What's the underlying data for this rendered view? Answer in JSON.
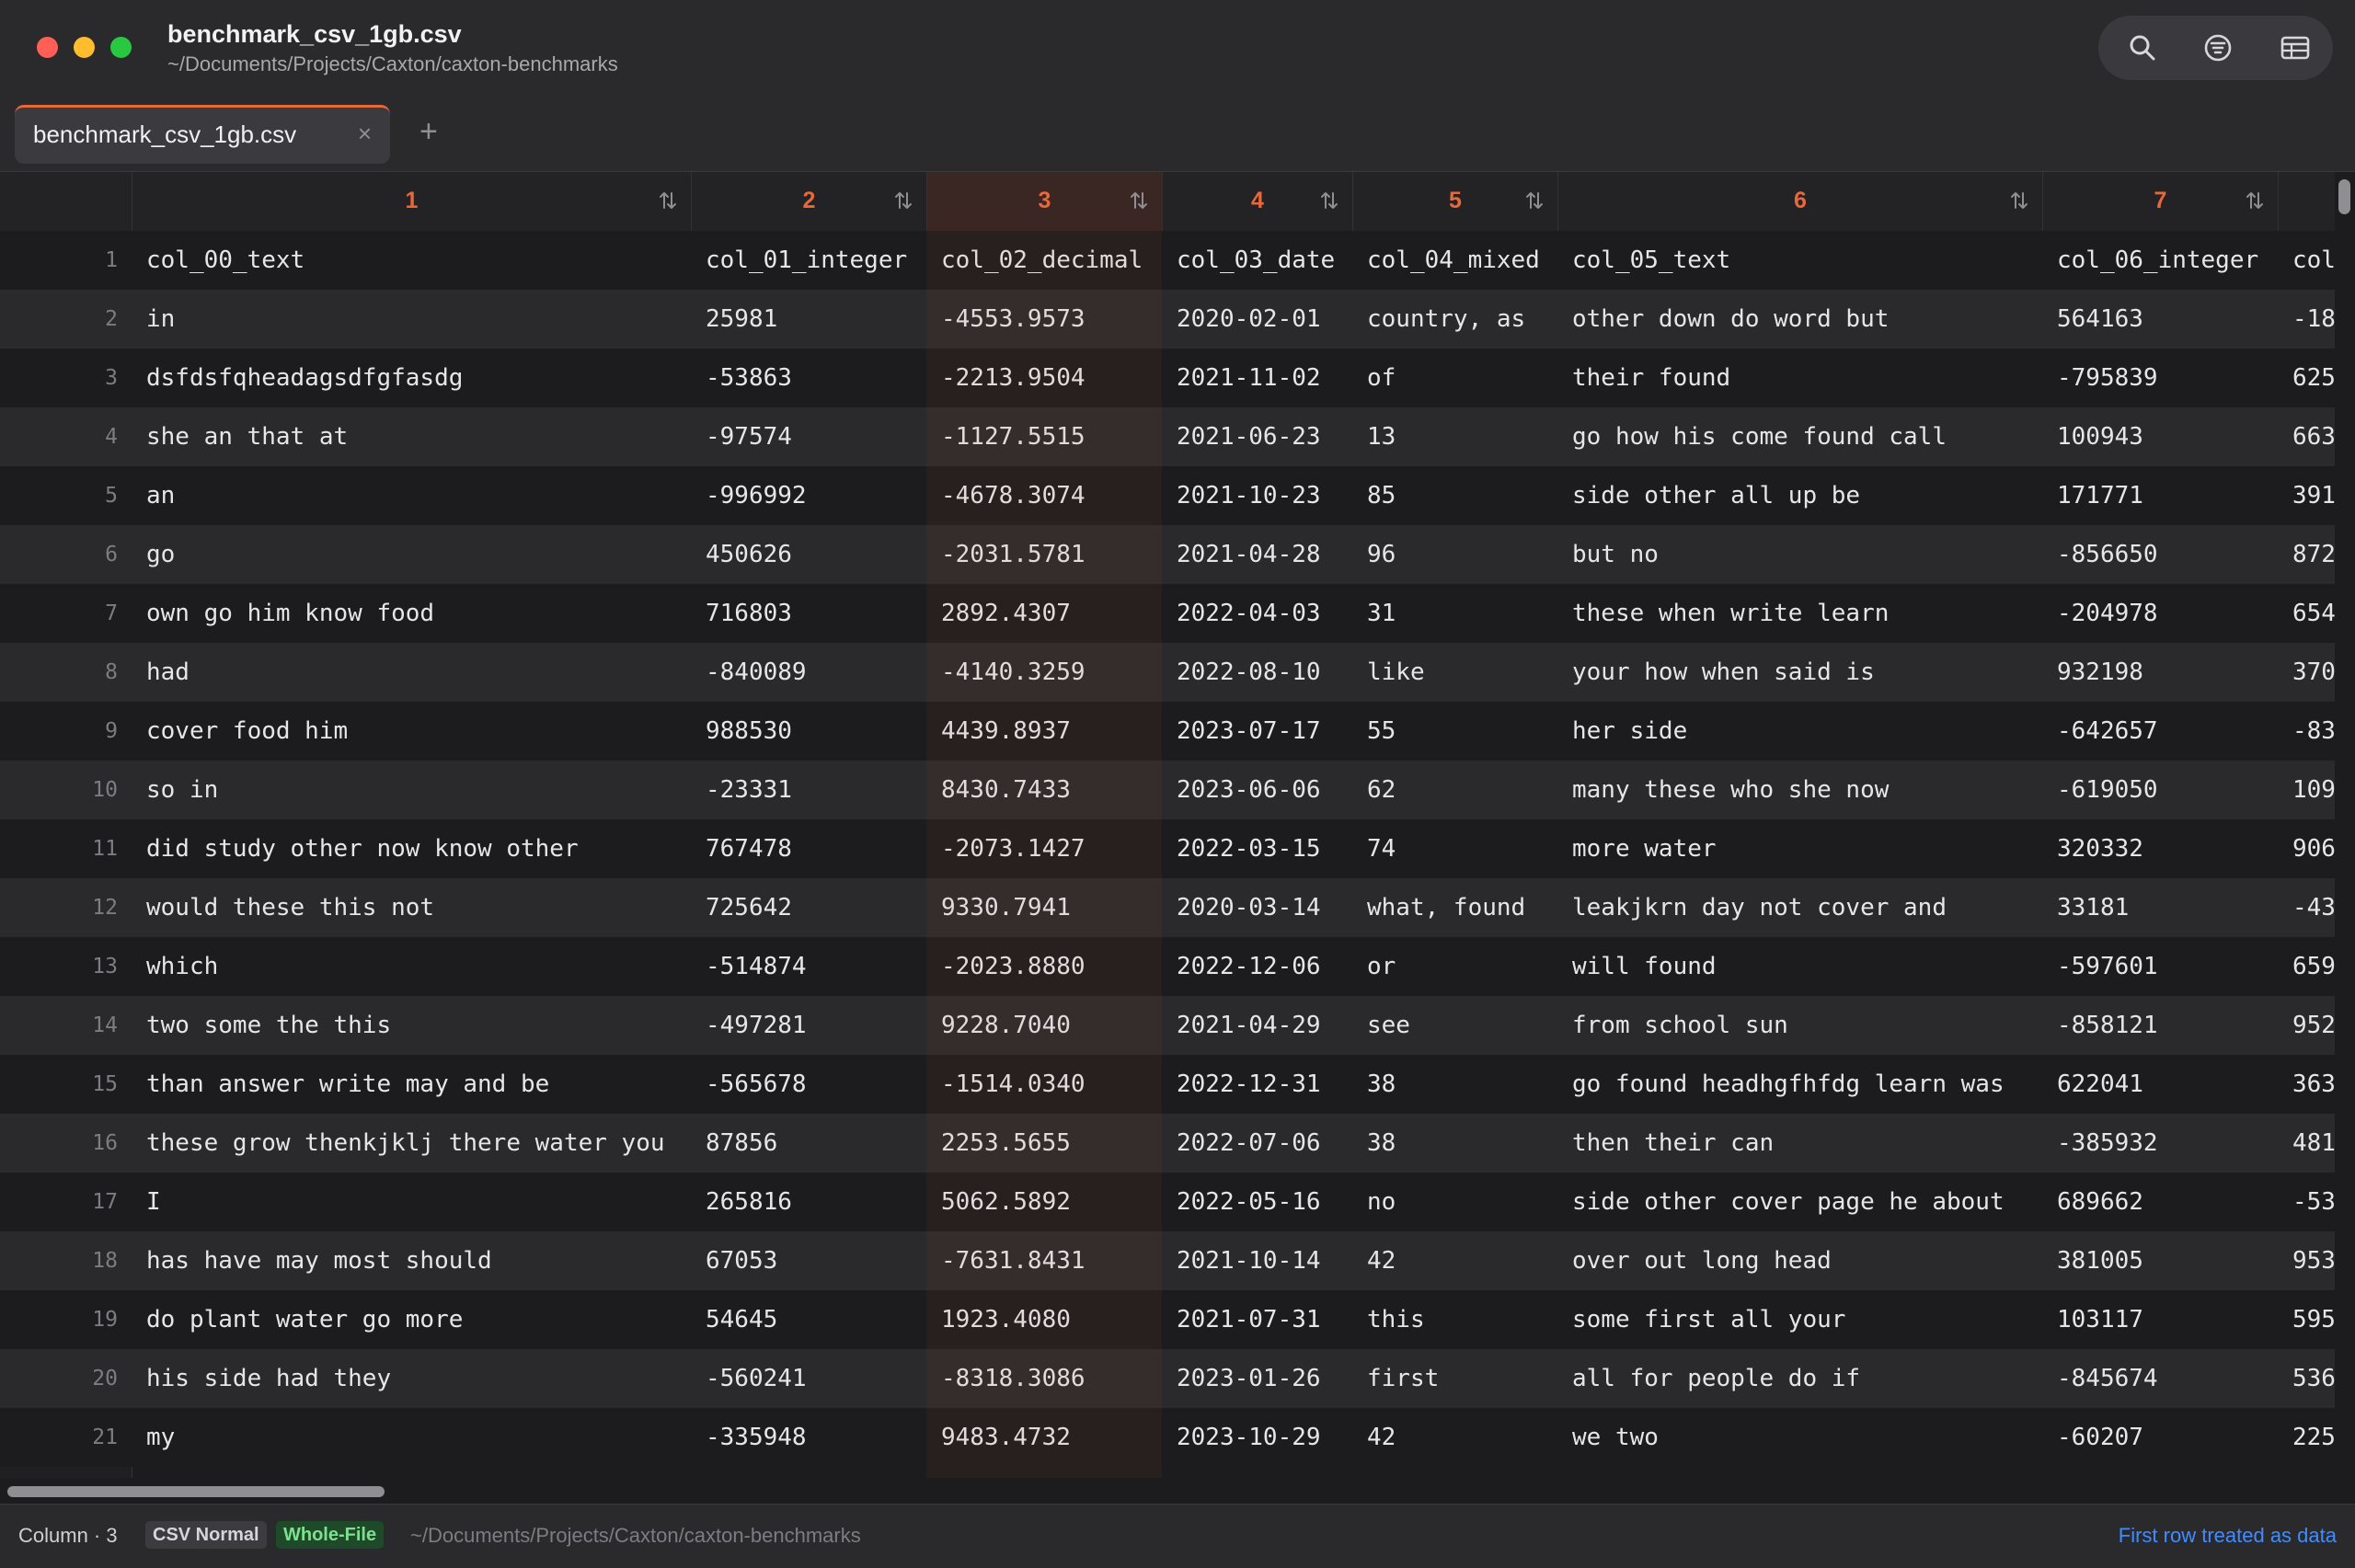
{
  "window": {
    "title": "benchmark_csv_1gb.csv",
    "path": "~/Documents/Projects/Caxton/caxton-benchmarks"
  },
  "toolbar": {
    "icons": [
      "search-icon",
      "filter-icon",
      "table-layout-icon"
    ]
  },
  "tabs": [
    {
      "label": "benchmark_csv_1gb.csv",
      "close": "×"
    }
  ],
  "tab_add": "+",
  "columns": [
    {
      "number": "1"
    },
    {
      "number": "2"
    },
    {
      "number": "3",
      "selected": true
    },
    {
      "number": "4"
    },
    {
      "number": "5"
    },
    {
      "number": "6"
    },
    {
      "number": "7"
    }
  ],
  "rows": [
    {
      "n": "1",
      "cells": [
        "col_00_text",
        "col_01_integer",
        "col_02_decimal",
        "col_03_date",
        "col_04_mixed",
        "col_05_text",
        "col_06_integer",
        "col"
      ]
    },
    {
      "n": "2",
      "cells": [
        "in",
        "25981",
        "-4553.9573",
        "2020-02-01",
        "country, as",
        "other down do word but",
        "564163",
        "-18"
      ]
    },
    {
      "n": "3",
      "cells": [
        "dsfdsfqheadagsdfgfasdg",
        "-53863",
        "-2213.9504",
        "2021-11-02",
        "of",
        "their found",
        "-795839",
        "625"
      ]
    },
    {
      "n": "4",
      "cells": [
        "she an that at",
        "-97574",
        "-1127.5515",
        "2021-06-23",
        "13",
        "go how his come found call",
        "100943",
        "663"
      ]
    },
    {
      "n": "5",
      "cells": [
        "an",
        "-996992",
        "-4678.3074",
        "2021-10-23",
        "85",
        "side other all up be",
        "171771",
        "391"
      ]
    },
    {
      "n": "6",
      "cells": [
        "go",
        "450626",
        "-2031.5781",
        "2021-04-28",
        "96",
        "but no",
        "-856650",
        "872"
      ]
    },
    {
      "n": "7",
      "cells": [
        "own go him know food",
        "716803",
        "2892.4307",
        "2022-04-03",
        "31",
        "these when write learn",
        "-204978",
        "654"
      ]
    },
    {
      "n": "8",
      "cells": [
        "had",
        "-840089",
        "-4140.3259",
        "2022-08-10",
        "like",
        "your how when said is",
        "932198",
        "370"
      ]
    },
    {
      "n": "9",
      "cells": [
        "cover food him",
        "988530",
        "4439.8937",
        "2023-07-17",
        "55",
        "her side",
        "-642657",
        "-83"
      ]
    },
    {
      "n": "10",
      "cells": [
        "so in",
        "-23331",
        "8430.7433",
        "2023-06-06",
        "62",
        "many these who she now",
        "-619050",
        "109"
      ]
    },
    {
      "n": "11",
      "cells": [
        "did study other now know other",
        "767478",
        "-2073.1427",
        "2022-03-15",
        "74",
        "more water",
        "320332",
        "906"
      ]
    },
    {
      "n": "12",
      "cells": [
        "would these this not",
        "725642",
        "9330.7941",
        "2020-03-14",
        "what, found",
        "leakjkrn day not cover and",
        "33181",
        "-43"
      ]
    },
    {
      "n": "13",
      "cells": [
        "which",
        "-514874",
        "-2023.8880",
        "2022-12-06",
        "or",
        "will found",
        "-597601",
        "659"
      ]
    },
    {
      "n": "14",
      "cells": [
        "two some the this",
        "-497281",
        "9228.7040",
        "2021-04-29",
        "see",
        "from school sun",
        "-858121",
        "952"
      ]
    },
    {
      "n": "15",
      "cells": [
        "than answer write may and be",
        "-565678",
        "-1514.0340",
        "2022-12-31",
        "38",
        "go found headhgfhfdg learn was",
        "622041",
        "363"
      ]
    },
    {
      "n": "16",
      "cells": [
        "these grow thenkjklj there water you",
        "87856",
        "2253.5655",
        "2022-07-06",
        "38",
        "then their can",
        "-385932",
        "481"
      ]
    },
    {
      "n": "17",
      "cells": [
        "I",
        "265816",
        "5062.5892",
        "2022-05-16",
        "no",
        "side other cover page he about",
        "689662",
        "-53"
      ]
    },
    {
      "n": "18",
      "cells": [
        "has have may most should",
        "67053",
        "-7631.8431",
        "2021-10-14",
        "42",
        "over out long head",
        "381005",
        "953"
      ]
    },
    {
      "n": "19",
      "cells": [
        "do plant water go more",
        "54645",
        "1923.4080",
        "2021-07-31",
        "this",
        "some first all your",
        "103117",
        "595"
      ]
    },
    {
      "n": "20",
      "cells": [
        "his side had they",
        "-560241",
        "-8318.3086",
        "2023-01-26",
        "first",
        "all for people do if",
        "-845674",
        "536"
      ]
    },
    {
      "n": "21",
      "cells": [
        "my",
        "-335948",
        "9483.4732",
        "2023-10-29",
        "42",
        "we two",
        "-60207",
        "225"
      ]
    }
  ],
  "status": {
    "column": "Column · 3",
    "badge_mode": "CSV Normal",
    "badge_scope": "Whole-File",
    "path": "~/Documents/Projects/Caxton/caxton-benchmarks",
    "right_link": "First row treated as data"
  },
  "colors": {
    "accent": "#e8683a",
    "link": "#3f8cff"
  }
}
